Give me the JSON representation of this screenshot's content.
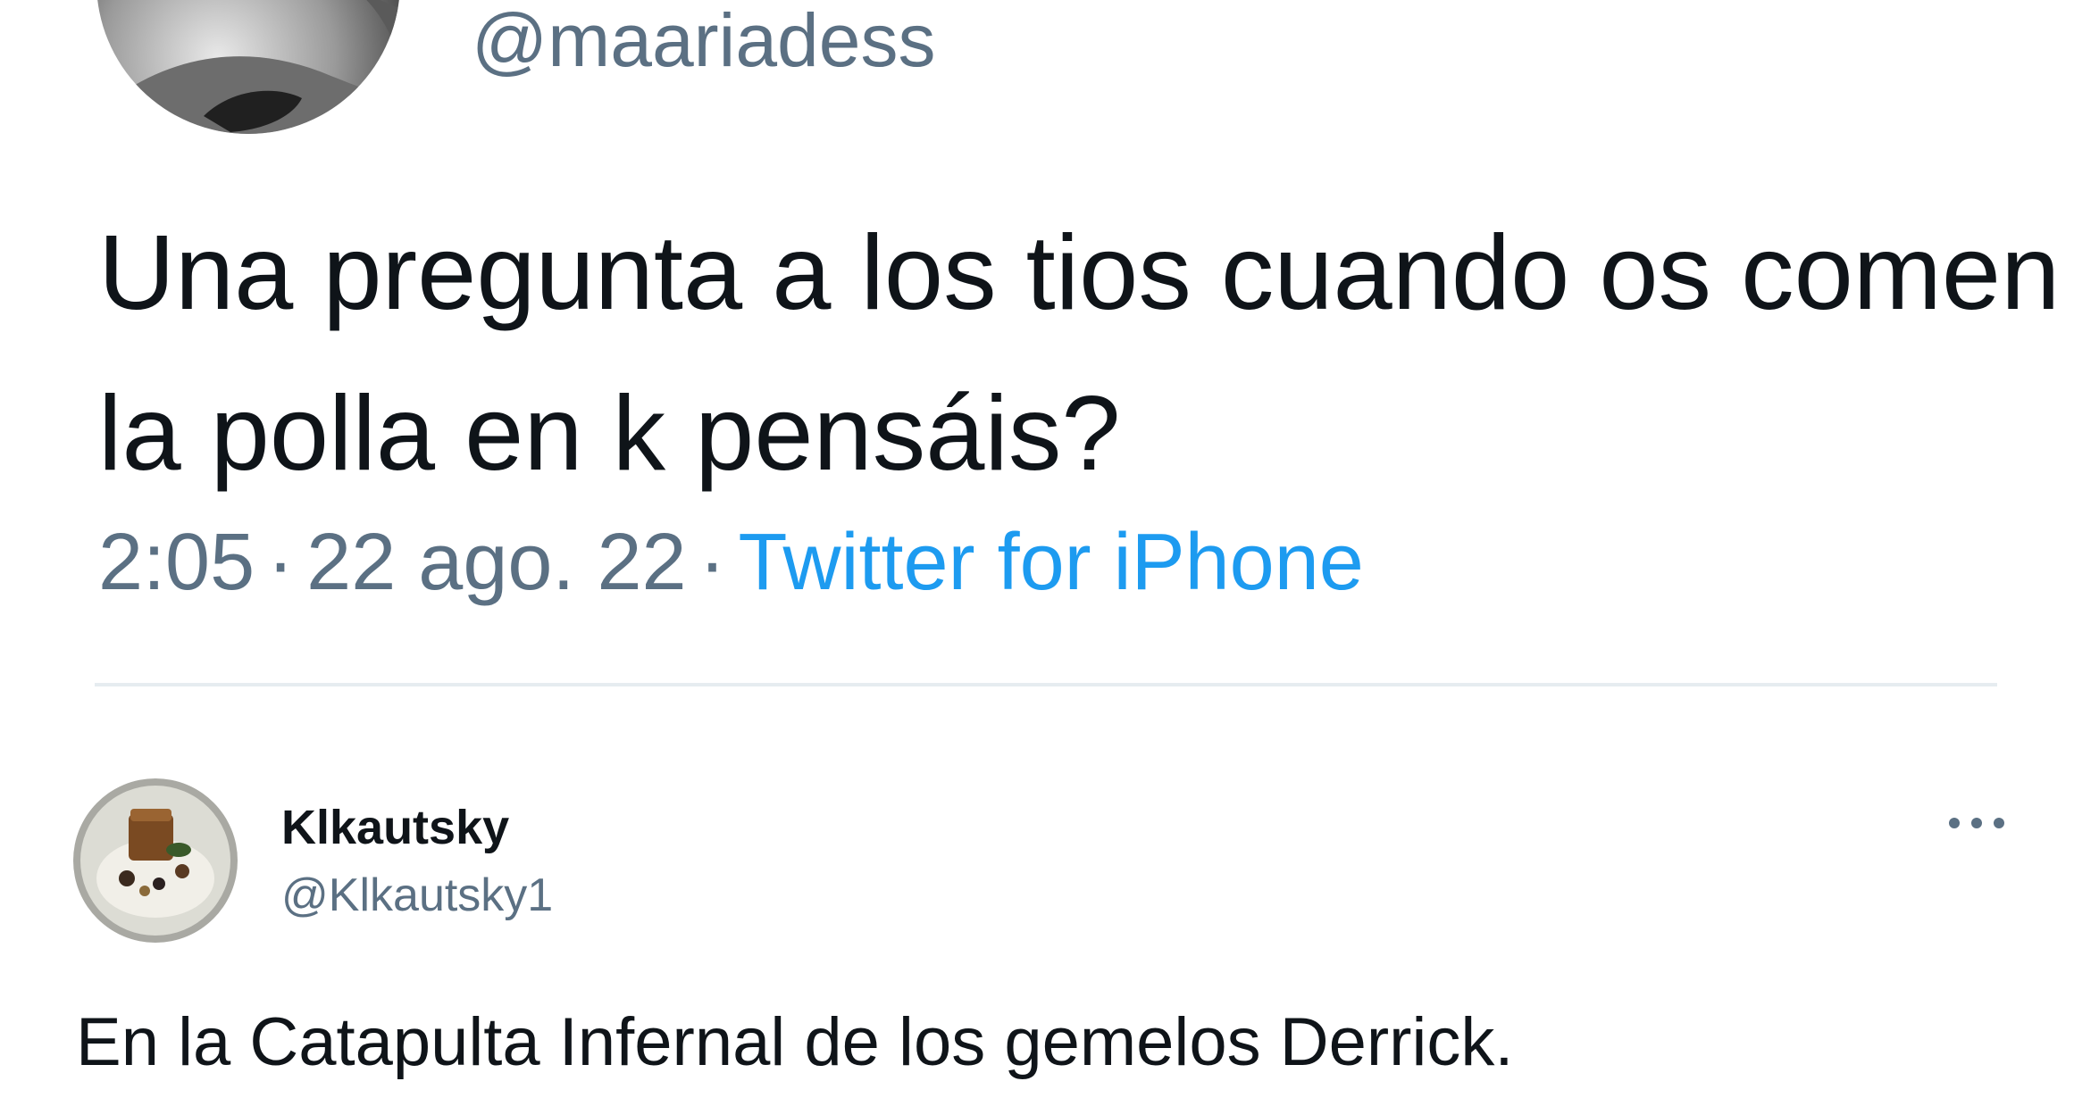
{
  "main_tweet": {
    "handle": "@maariadess",
    "text": "Una pregunta a los tios cuando os comen la polla en k pensáis?",
    "time": "2:05",
    "date": "22 ago. 22",
    "separator": "·",
    "source": "Twitter for iPhone"
  },
  "reply_tweet": {
    "display_name": "Klkautsky",
    "handle": "@Klkautsky1",
    "text": "En la Catapulta Infernal de los gemelos Derrick."
  },
  "colors": {
    "text_primary": "#0f1419",
    "text_secondary": "#5b7083",
    "link": "#1d9bf0",
    "divider": "#e6ecf0"
  },
  "icons": {
    "more": "more-horizontal-icon"
  }
}
